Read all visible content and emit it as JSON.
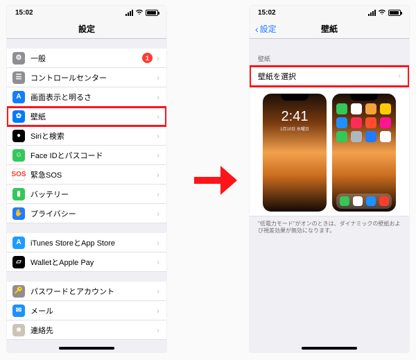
{
  "arrow": {
    "color": "#ff141a"
  },
  "left": {
    "time": "15:02",
    "title": "設定",
    "rows": [
      {
        "id": "general",
        "label": "一般",
        "badge": "1",
        "iconSym": "⚙",
        "cls": "c-gray"
      },
      {
        "id": "control-center",
        "label": "コントロールセンター",
        "iconSym": "☰",
        "cls": "c-gray"
      },
      {
        "id": "display-brightness",
        "label": "画面表示と明るさ",
        "iconSym": "A",
        "cls": "c-blue"
      },
      {
        "id": "wallpaper",
        "label": "壁紙",
        "iconSym": "✿",
        "cls": "c-cyan",
        "highlight": true
      },
      {
        "id": "siri-search",
        "label": "Siriと検索",
        "iconSym": "●",
        "cls": "c-black"
      },
      {
        "id": "faceid-passcode",
        "label": "Face IDとパスコード",
        "iconSym": "☺",
        "cls": "c-green"
      },
      {
        "id": "emergency-sos",
        "label": "緊急SOS",
        "iconSym": "SOS",
        "cls": "c-sos"
      },
      {
        "id": "battery",
        "label": "バッテリー",
        "iconSym": "▮",
        "cls": "c-green"
      },
      {
        "id": "privacy",
        "label": "プライバシー",
        "iconSym": "✋",
        "cls": "c-priv"
      }
    ],
    "rows2": [
      {
        "id": "itunes-appstore",
        "label": "iTunes StoreとApp Store",
        "iconSym": "A",
        "cls": "c-store"
      },
      {
        "id": "wallet-applepay",
        "label": "WalletとApple Pay",
        "iconSym": "▱",
        "cls": "c-wallet"
      }
    ],
    "rows3": [
      {
        "id": "passwords-accounts",
        "label": "パスワードとアカウント",
        "iconSym": "🔑",
        "cls": "c-key"
      },
      {
        "id": "mail",
        "label": "メール",
        "iconSym": "✉",
        "cls": "c-mail"
      },
      {
        "id": "contacts",
        "label": "連絡先",
        "iconSym": "☻",
        "cls": "c-contacts"
      }
    ]
  },
  "right": {
    "time": "15:02",
    "back": "設定",
    "title": "壁紙",
    "section_header": "壁紙",
    "choose_label": "壁紙を選択",
    "lock_clock": "2:41",
    "lock_date": "1月10日 水曜日",
    "footnote": "\"低電力モード\"がオンのときは、ダイナミックの壁紙および視差効果が無効になります。",
    "home_colors": [
      "#34c759",
      "#fff",
      "#f2a33c",
      "#ffcc00",
      "#1e90ff",
      "#ff2d55",
      "#ff4e2e",
      "#ff1493",
      "#34c759",
      "#aeb7c0",
      "#1f7cff",
      "#fff"
    ],
    "dock_colors": [
      "#34c759",
      "#fff",
      "#1e90ff",
      "#ff3b30"
    ]
  }
}
